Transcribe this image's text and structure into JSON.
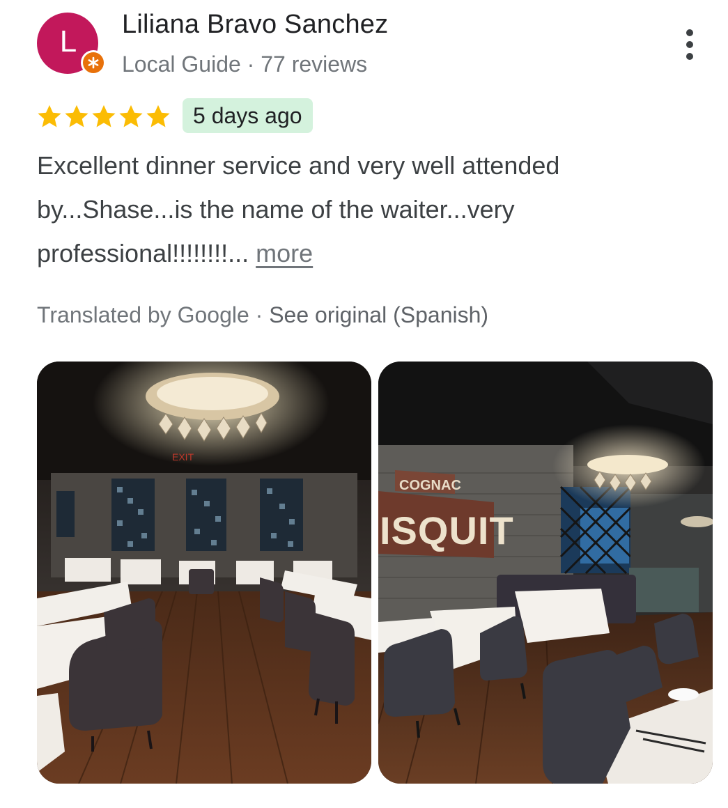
{
  "reviewer": {
    "avatar_letter": "L",
    "name": "Liliana Bravo Sanchez",
    "meta": "Local Guide · 77 reviews",
    "badge_icon": "local-guide-star-icon",
    "avatar_color": "#c2185b",
    "badge_color": "#e8710a"
  },
  "menu": {
    "icon": "more-vert-icon"
  },
  "rating": {
    "stars": 5,
    "max": 5,
    "star_color": "#fbbc04",
    "date": "5 days ago",
    "date_chip_color": "#d4f2dd"
  },
  "review": {
    "text": "Excellent dinner service and very well attended by...Shase...is the name of the waiter...very professional!!!!!!!!...",
    "more_label": "more"
  },
  "translation": {
    "translated_by": "Translated by Google",
    "separator": "·",
    "see_original": "See original (Spanish)"
  },
  "photos": [
    {
      "subject": "restaurant dining room with chandelier"
    },
    {
      "subject": "restaurant dining room with vintage sign"
    }
  ],
  "photo_sign": {
    "line1": "COGNAC",
    "line2": "ISQUIT",
    "exit": "EXIT"
  }
}
